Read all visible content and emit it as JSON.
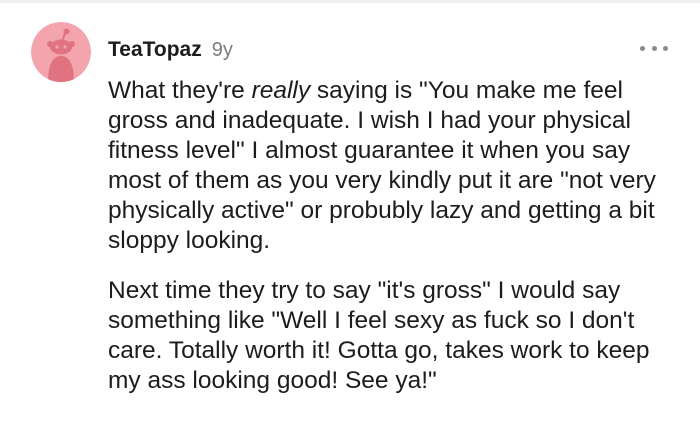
{
  "comment": {
    "author": "TeaTopaz",
    "age": "9y",
    "paragraph1": {
      "before": "What they're ",
      "emphasis": "really",
      "after": " saying is \"You make me feel gross and inadequate. I wish I had your physical fitness level\" I almost guarantee it when you say most of them as you very kindly put it are \"not very physically active\" or probubly lazy and getting a bit sloppy looking."
    },
    "paragraph2": "Next time they try to say \"it's gross\" I would say something like \"Well I feel sexy as fuck so I don't care. Totally worth it! Gotta go, takes work to keep my ass looking good! See ya!\""
  },
  "icons": {
    "avatar": "snoo-avatar-icon",
    "more": "more-options-icon"
  },
  "colors": {
    "avatar_bg": "#f3a4ad",
    "avatar_figure": "#e0737f",
    "username": "#1c1c1c",
    "age": "#7c7c7c",
    "text": "#1c1c1c",
    "more_dots": "#878a8c"
  }
}
